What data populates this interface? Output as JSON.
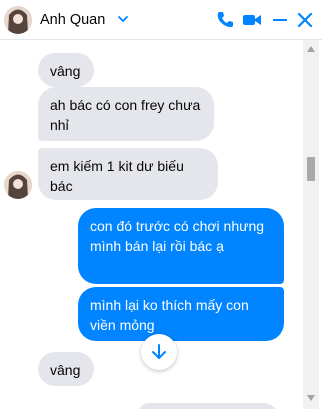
{
  "header": {
    "contact_name": "Anh Quan",
    "icons": [
      "chevron-down-icon",
      "phone-icon",
      "video-icon",
      "minimize-icon",
      "close-icon"
    ],
    "accent_color": "#0084ff"
  },
  "messages": [
    {
      "direction": "incoming",
      "text": "vâng"
    },
    {
      "direction": "incoming",
      "text": "ah bác có con frey chưa nhỉ"
    },
    {
      "direction": "incoming",
      "text": "em kiếm 1 kit dư biếu bác"
    },
    {
      "direction": "outgoing",
      "text": "con đó trước có chơi nhưng mình bán lại rồi bác ạ"
    },
    {
      "direction": "outgoing",
      "text": "mình lại ko thích mấy con viền mỏng"
    },
    {
      "direction": "incoming",
      "text": "vâng"
    }
  ],
  "colors": {
    "incoming_bubble": "#e4e6eb",
    "outgoing_bubble": "#0084ff"
  },
  "jump_button_icon": "arrow-down-icon"
}
